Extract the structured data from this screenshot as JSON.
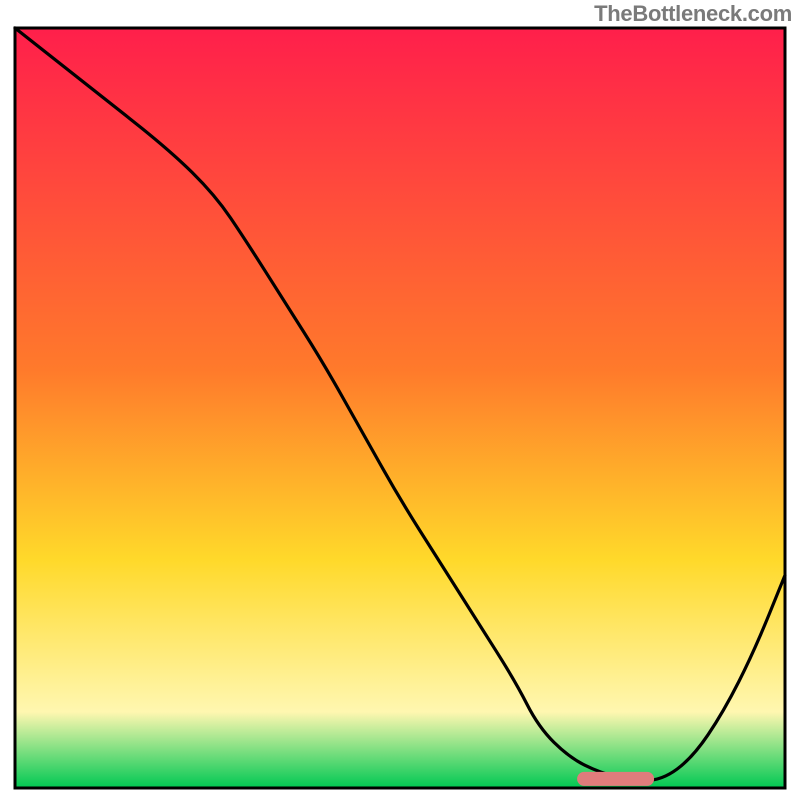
{
  "watermark": "TheBottleneck.com",
  "colors": {
    "gradient_top": "#ff1f4b",
    "gradient_mid1": "#ff7a2b",
    "gradient_mid2": "#ffd92a",
    "gradient_mid3": "#fff7b0",
    "gradient_bottom": "#00c853",
    "curve": "#000000",
    "marker": "#e07c7c",
    "frame": "#000000"
  },
  "chart_data": {
    "type": "line",
    "title": "",
    "xlabel": "",
    "ylabel": "",
    "xlim": [
      0,
      100
    ],
    "ylim": [
      0,
      100
    ],
    "x": [
      0,
      10,
      20,
      26,
      30,
      35,
      40,
      45,
      50,
      55,
      60,
      65,
      68,
      72,
      76,
      80,
      84,
      88,
      92,
      96,
      100
    ],
    "values": [
      100,
      92,
      84,
      78,
      72,
      64,
      56,
      47,
      38,
      30,
      22,
      14,
      8,
      4,
      2,
      1,
      1,
      4,
      10,
      18,
      28
    ],
    "marker_range_x": [
      73,
      83
    ],
    "annotations": []
  }
}
